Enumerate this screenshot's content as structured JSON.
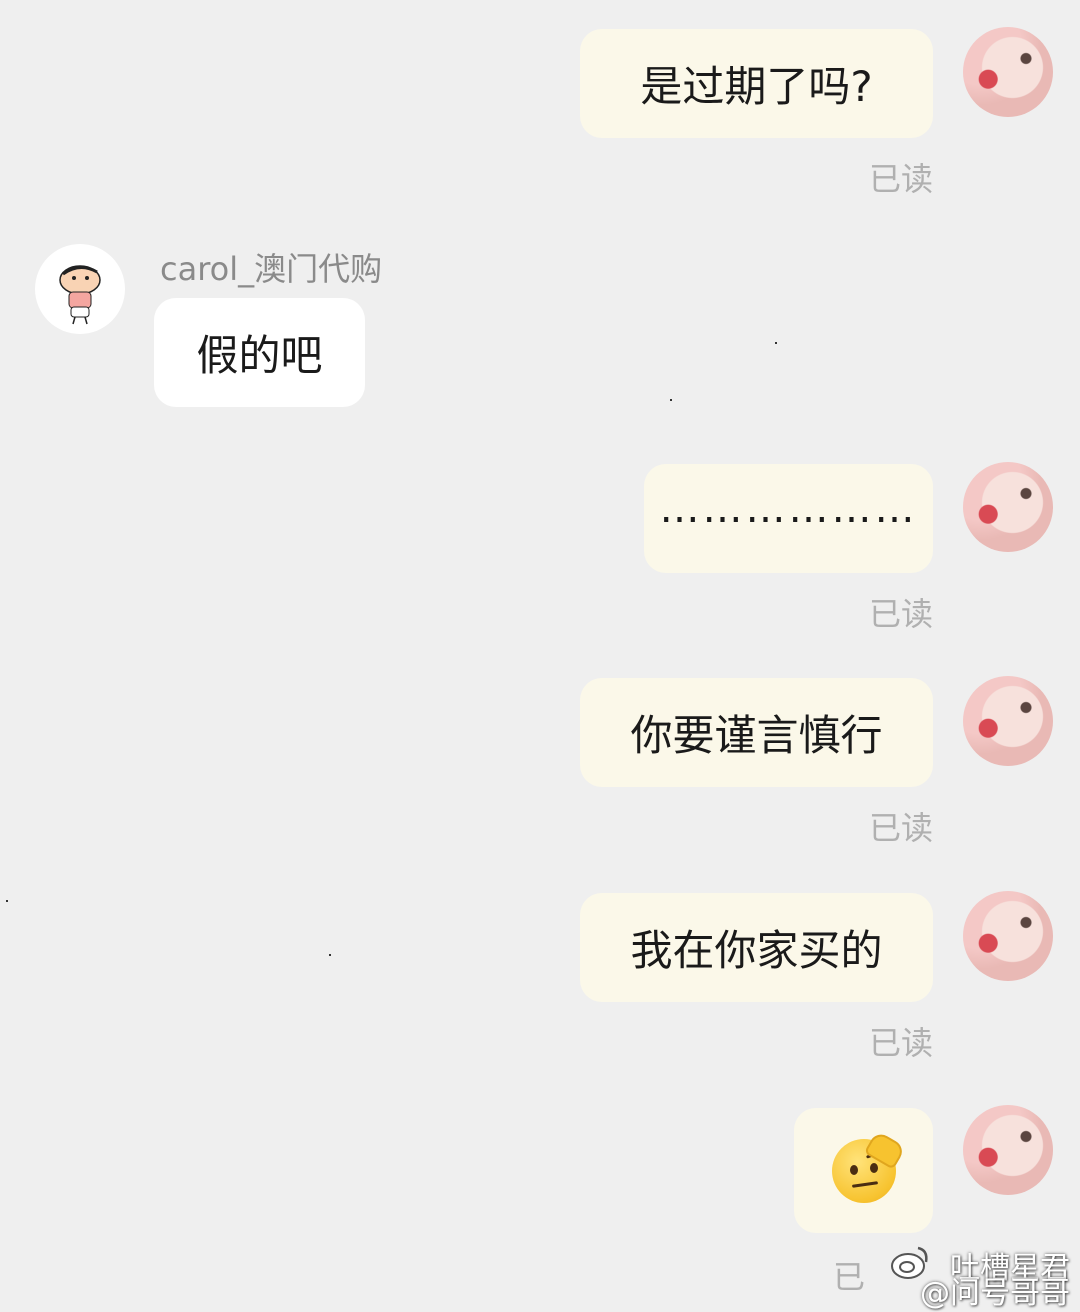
{
  "conversation": {
    "other_user": {
      "name": "carol_澳门代购"
    },
    "messages": [
      {
        "side": "out",
        "text": "是过期了吗?",
        "status": "已读"
      },
      {
        "side": "in",
        "text": "假的吧"
      },
      {
        "side": "out",
        "text": "………………",
        "status": "已读"
      },
      {
        "side": "out",
        "text": "你要谨言慎行",
        "status": "已读"
      },
      {
        "side": "out",
        "text": "我在你家买的",
        "status": "已读"
      },
      {
        "side": "out",
        "emoji": "raised-eyebrow-face-icon",
        "status": "已"
      }
    ]
  },
  "watermark": {
    "line1": "吐槽星君",
    "line2": "@问号哥哥"
  },
  "colors": {
    "background": "#efefef",
    "outgoing_bubble": "#fbf8e9",
    "incoming_bubble": "#ffffff",
    "read_status": "#b0b0b0",
    "username": "#8a8a8a"
  }
}
